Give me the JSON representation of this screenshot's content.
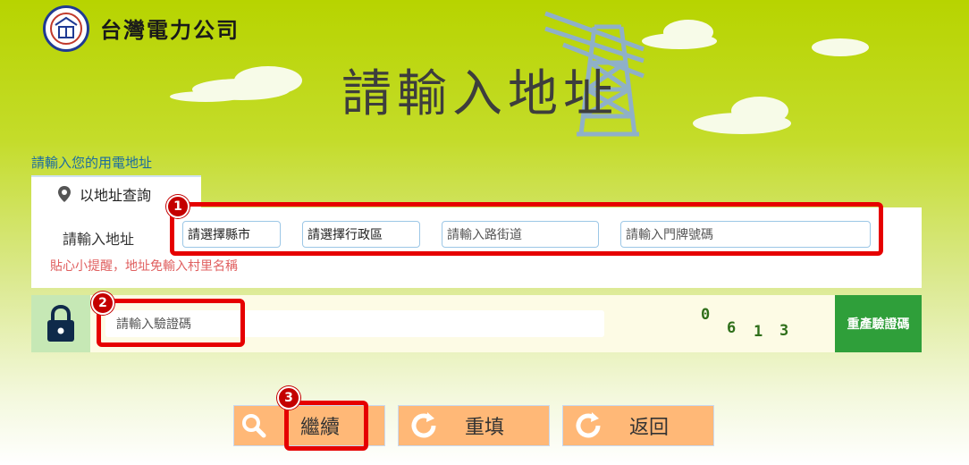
{
  "header": {
    "company_name": "台灣電力公司",
    "logo_mark": "台電",
    "page_title": "請輸入地址"
  },
  "section_label": "請輸入您的用電地址",
  "address_search": {
    "tab_label": "以地址查詢",
    "row_label": "請輸入地址",
    "city_select": "請選擇縣市",
    "district_select": "請選擇行政區",
    "road_placeholder": "請輸入路街道",
    "number_placeholder": "請輸入門牌號碼",
    "hint": "貼心小提醒，地址免輸入村里名稱"
  },
  "captcha": {
    "placeholder": "請輸入驗證碼",
    "chars": [
      "0",
      "6",
      "1",
      "3"
    ],
    "regenerate_label": "重產驗證碼"
  },
  "actions": {
    "continue_label": "繼續",
    "reset_label": "重填",
    "back_label": "返回"
  },
  "annotations": [
    "1",
    "2",
    "3"
  ],
  "colors": {
    "annotation_red": "#e60000",
    "button_orange": "#ffb877",
    "regen_green": "#2f9f3a"
  }
}
